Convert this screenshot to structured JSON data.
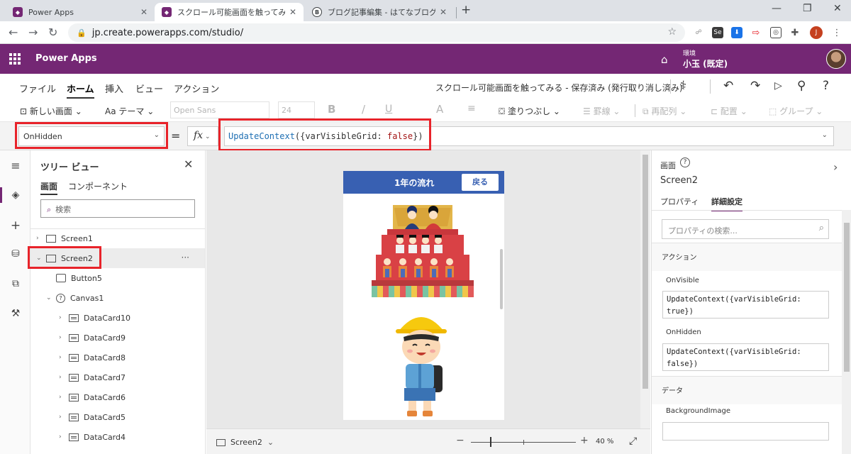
{
  "browser": {
    "tabs": [
      {
        "title": "Power Apps",
        "favicon": "power-apps-icon",
        "active": false
      },
      {
        "title": "スクロール可能画面を触ってみる - 保",
        "favicon": "power-apps-icon",
        "active": true
      },
      {
        "title": "ブログ記事編集 - はてなブログ",
        "favicon": "hatena-icon",
        "active": false
      }
    ],
    "new_tab_label": "+",
    "url": "jp.create.powerapps.com/studio/",
    "profile_initial": "J"
  },
  "app": {
    "title": "Power Apps",
    "environment_label": "環境",
    "environment_name": "小玉 (既定)"
  },
  "menu": {
    "items": [
      "ファイル",
      "ホーム",
      "挿入",
      "ビュー",
      "アクション"
    ],
    "active": "ホーム",
    "document_title": "スクロール可能画面を触ってみる - 保存済み (発行取り消し済み)"
  },
  "toolbar": {
    "new_screen": "新しい画面",
    "theme": "テーマ",
    "font": "Open Sans",
    "font_size": "24",
    "bold": "B",
    "italic": "/",
    "underline": "U",
    "font_color": "A",
    "fill": "塗りつぶし",
    "border": "罫線",
    "reorder": "再配列",
    "align": "配置",
    "group": "グループ"
  },
  "formula_bar": {
    "property": "OnHidden",
    "equals": "=",
    "fx": "fx",
    "function": "UpdateContext",
    "args_open": "({varVisibleGrid: ",
    "value": "false",
    "args_close": "})"
  },
  "tree": {
    "title": "ツリー ビュー",
    "tabs": [
      "画面",
      "コンポーネント"
    ],
    "search_placeholder": "検索",
    "nodes": [
      {
        "label": "Screen1",
        "type": "screen"
      },
      {
        "label": "Screen2",
        "type": "screen"
      },
      {
        "label": "Button5",
        "type": "button"
      },
      {
        "label": "Canvas1",
        "type": "canvas"
      },
      {
        "label": "DataCard10",
        "type": "card"
      },
      {
        "label": "DataCard9",
        "type": "card"
      },
      {
        "label": "DataCard8",
        "type": "card"
      },
      {
        "label": "DataCard7",
        "type": "card"
      },
      {
        "label": "DataCard6",
        "type": "card"
      },
      {
        "label": "DataCard5",
        "type": "card"
      },
      {
        "label": "DataCard4",
        "type": "card"
      }
    ],
    "more": "···"
  },
  "canvas": {
    "header_title": "1年の流れ",
    "back_button": "戻る"
  },
  "status": {
    "screen": "Screen2",
    "zoom_value": "40",
    "zoom_unit": "%",
    "zoom_minus": "−",
    "zoom_plus": "+"
  },
  "properties": {
    "kind": "画面",
    "name": "Screen2",
    "tabs": [
      "プロパティ",
      "詳細設定"
    ],
    "active_tab": "詳細設定",
    "search_placeholder": "プロパティの検索...",
    "section_action": "アクション",
    "onvisible_label": "OnVisible",
    "onvisible_line1": "UpdateContext({varVisibleGrid:",
    "onvisible_line2": "true})",
    "onhidden_label": "OnHidden",
    "onhidden_line1": "UpdateContext({varVisibleGrid:",
    "onhidden_line2": "false})",
    "section_data": "データ",
    "background_image_label": "BackgroundImage"
  },
  "colors": {
    "brand": "#742774",
    "highlight": "#e8232a",
    "canvas_header": "#3860b2"
  }
}
